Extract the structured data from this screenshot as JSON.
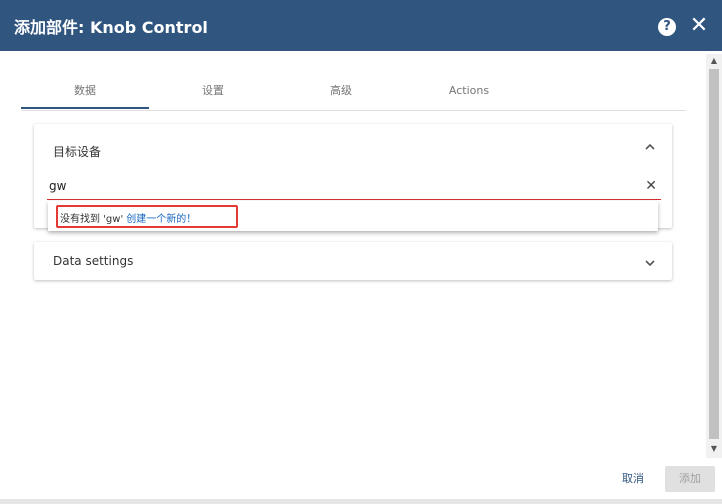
{
  "dialog": {
    "title": "添加部件: Knob Control",
    "help_icon": "help-circle-icon",
    "close_icon": "close-icon",
    "colors": {
      "header": "#305680",
      "accent": "#305680",
      "error": "#d32f2f",
      "link": "#1565c0"
    }
  },
  "tabs": [
    {
      "label": "数据",
      "active": true
    },
    {
      "label": "设置",
      "active": false
    },
    {
      "label": "高级",
      "active": false
    },
    {
      "label": "Actions",
      "active": false
    }
  ],
  "target_device": {
    "title": "目标设备",
    "expanded": true,
    "input_value": "gw",
    "dropdown": {
      "message": "没有找到 'gw'",
      "link_text": "创建一个新的！"
    }
  },
  "data_settings": {
    "title": "Data settings",
    "expanded": false
  },
  "footer": {
    "cancel_label": "取消",
    "add_label": "添加"
  }
}
